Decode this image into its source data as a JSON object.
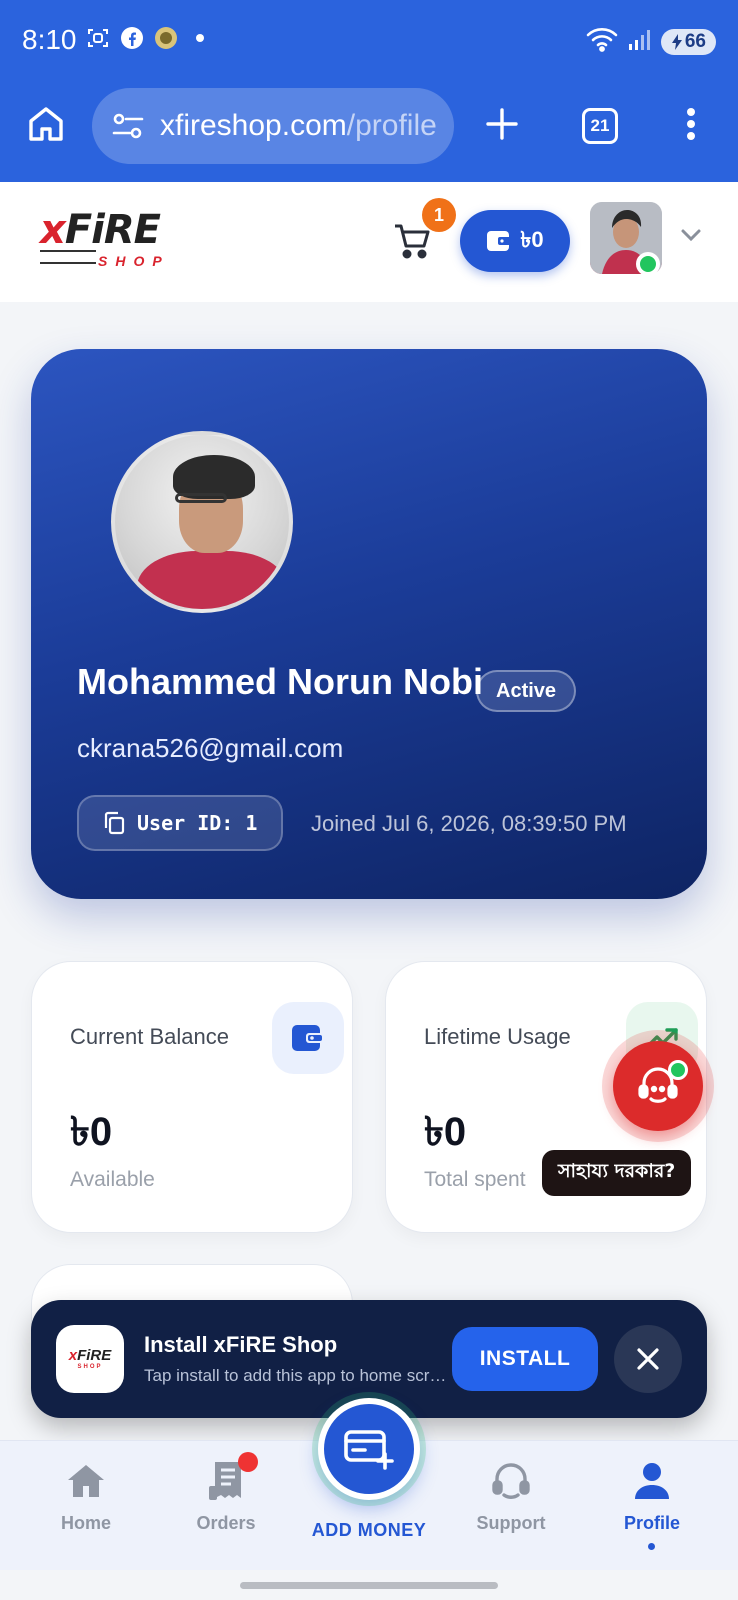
{
  "status_bar": {
    "time": "8:10",
    "battery": "66",
    "signal_label": "5"
  },
  "browser": {
    "url_domain": "xfireshop.com",
    "url_path": "/profile",
    "tab_count": "21"
  },
  "header": {
    "logo_main_x": "x",
    "logo_main_rest": "FiRE",
    "logo_sub": "SHOP",
    "cart_count": "1",
    "wallet_balance": "৳0"
  },
  "profile": {
    "name": "Mohammed Norun Nobi",
    "status": "Active",
    "email": "ckrana526@gmail.com",
    "user_id": "User ID: 1",
    "joined": "Joined Jul 6, 2026, 08:39:50 PM"
  },
  "stats": {
    "balance": {
      "label": "Current Balance",
      "value": "৳0",
      "sub": "Available"
    },
    "usage": {
      "label": "Lifetime Usage",
      "value": "৳0",
      "sub": "Total spent"
    }
  },
  "support": {
    "tooltip": "সাহায্য দরকার?"
  },
  "install_banner": {
    "title": "Install xFiRE Shop",
    "description": "Tap install to add this app to home screen",
    "install_label": "INSTALL",
    "logo_x": "x",
    "logo_rest": "FiRE",
    "logo_sub": "SHOP"
  },
  "bottom_nav": {
    "home": "Home",
    "orders": "Orders",
    "add_money": "ADD MONEY",
    "support": "Support",
    "profile": "Profile"
  },
  "colors": {
    "brand_blue": "#2457d3",
    "chrome_blue": "#2b63dd",
    "accent_red": "#d9232d",
    "online_green": "#22c55e",
    "cart_badge_orange": "#f07118"
  }
}
